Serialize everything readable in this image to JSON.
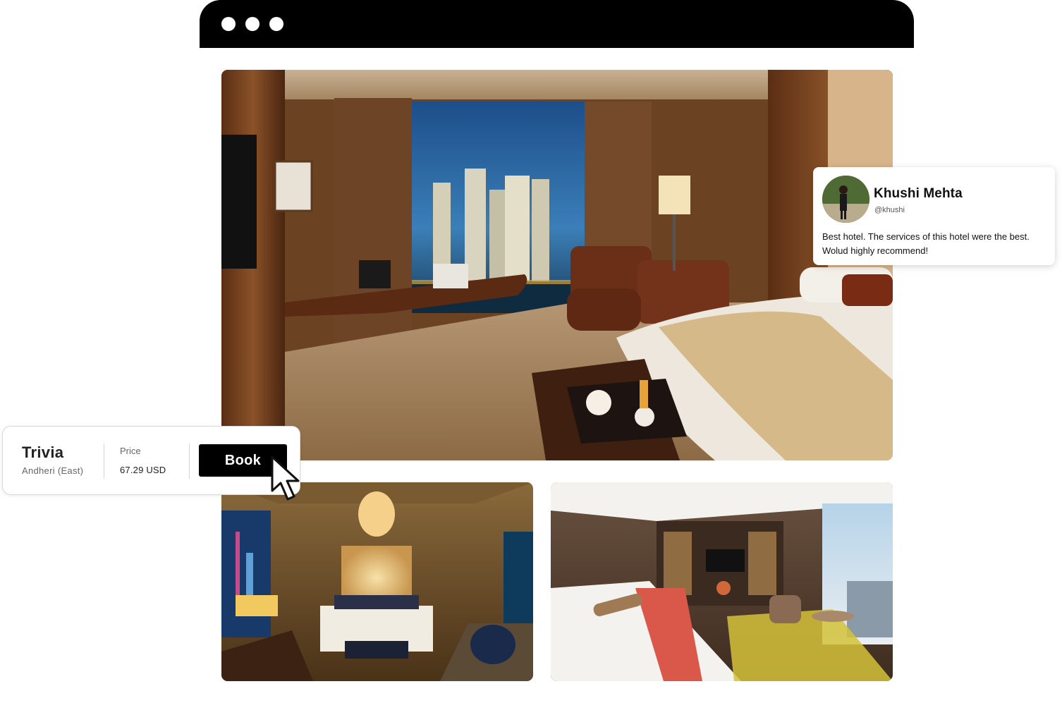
{
  "window": {
    "controls": [
      "window-dot",
      "window-dot",
      "window-dot"
    ]
  },
  "gallery": {
    "images": [
      "hotel-room-city-view",
      "hotel-bedroom-night",
      "hotel-bedroom-modern"
    ]
  },
  "review": {
    "name": "Khushi Mehta",
    "handle": "@khushi",
    "text": "Best hotel. The services of this hotel were the best. Wolud highly recommend!"
  },
  "booking": {
    "hotel_name": "Trivia",
    "location": "Andheri (East)",
    "price_label": "Price",
    "price_value": "67.29 USD",
    "book_label": "Book"
  },
  "colors": {
    "window_bar": "#000000",
    "button": "#000000",
    "background": "#ffffff"
  }
}
